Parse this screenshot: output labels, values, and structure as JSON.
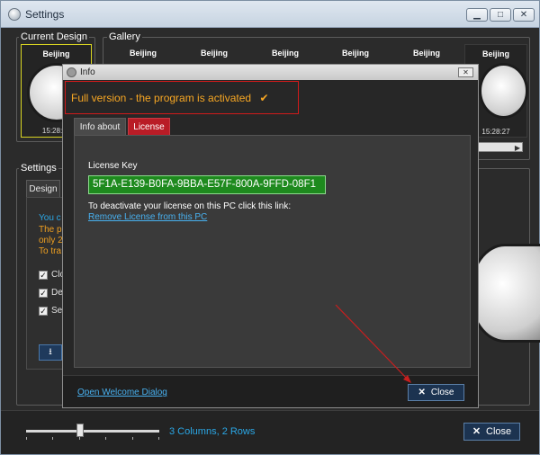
{
  "window": {
    "title": "Settings",
    "icon": "gear-icon"
  },
  "current_design": {
    "label": "Current Design",
    "clock": {
      "city": "Beijing",
      "time": "15:28:27"
    }
  },
  "gallery": {
    "label": "Gallery",
    "clocks": [
      {
        "city": "Beijing"
      },
      {
        "city": "Beijing"
      },
      {
        "city": "Beijing"
      },
      {
        "city": "Beijing"
      },
      {
        "city": "Beijing"
      },
      {
        "city": "Beijing",
        "time": "15:28:27"
      }
    ]
  },
  "settings": {
    "label": "Settings",
    "tab_design": "Design",
    "text_blue": "You c",
    "text_orange": [
      "The p",
      "only 2",
      "To tra"
    ],
    "checkboxes": [
      "Clo",
      "De",
      "Set"
    ]
  },
  "bottom": {
    "columns_label": "3 Columns, 2 Rows",
    "close_label": "Close"
  },
  "dialog": {
    "title": "Info",
    "activated_text": "Full version - the program is activated",
    "tabs": {
      "info": "Info about",
      "license": "License"
    },
    "license_key_label": "License Key",
    "license_key": "5F1A-E139-B0FA-9BBA-E57F-800A-9FFD-08F1",
    "deactivate_text": "To deactivate your license on this PC click this link:",
    "remove_link": "Remove License from this PC",
    "welcome_link": "Open Welcome Dialog",
    "close_label": "Close"
  },
  "colors": {
    "accent_orange": "#f6a623",
    "license_tab_red": "#b91c26",
    "license_key_green": "#1e8a1e",
    "link_blue": "#48b1f0",
    "highlight_red": "#d11a1a"
  }
}
